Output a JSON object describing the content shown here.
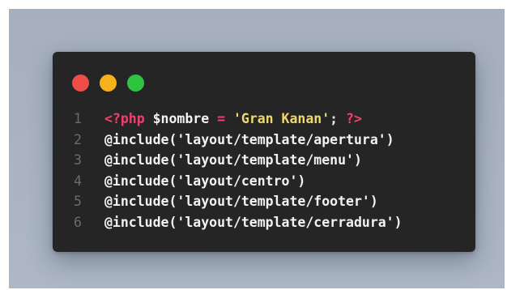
{
  "window_buttons": [
    {
      "name": "close",
      "color": "#ef4c4a"
    },
    {
      "name": "minimize",
      "color": "#f7b11c"
    },
    {
      "name": "maximize",
      "color": "#2fc43f"
    }
  ],
  "colors": {
    "default": "#f2f2f2",
    "php_tag": "#f43f6e",
    "operator": "#f43f6e",
    "string": "#f0d86a",
    "variable": "#f2f2f2",
    "punct": "#e8e8e8"
  },
  "code_lines": [
    {
      "number": "1",
      "tokens": [
        {
          "text": "<?php",
          "kind": "php_tag"
        },
        {
          "text": " $nombre ",
          "kind": "variable"
        },
        {
          "text": "=",
          "kind": "operator"
        },
        {
          "text": " 'Gran Kanan'",
          "kind": "string"
        },
        {
          "text": "; ",
          "kind": "punct"
        },
        {
          "text": "?>",
          "kind": "php_tag"
        }
      ]
    },
    {
      "number": "2",
      "tokens": [
        {
          "text": "@include(",
          "kind": "default"
        },
        {
          "text": "'layout/template/apertura'",
          "kind": "default"
        },
        {
          "text": ")",
          "kind": "default"
        }
      ]
    },
    {
      "number": "3",
      "tokens": [
        {
          "text": "@include(",
          "kind": "default"
        },
        {
          "text": "'layout/template/menu'",
          "kind": "default"
        },
        {
          "text": ")",
          "kind": "default"
        }
      ]
    },
    {
      "number": "4",
      "tokens": [
        {
          "text": "@include(",
          "kind": "default"
        },
        {
          "text": "'layout/centro'",
          "kind": "default"
        },
        {
          "text": ")",
          "kind": "default"
        }
      ]
    },
    {
      "number": "5",
      "tokens": [
        {
          "text": "@include(",
          "kind": "default"
        },
        {
          "text": "'layout/template/footer'",
          "kind": "default"
        },
        {
          "text": ")",
          "kind": "default"
        }
      ]
    },
    {
      "number": "6",
      "tokens": [
        {
          "text": "@include(",
          "kind": "default"
        },
        {
          "text": "'layout/template/cerradura'",
          "kind": "default"
        },
        {
          "text": ")",
          "kind": "default"
        }
      ]
    }
  ]
}
